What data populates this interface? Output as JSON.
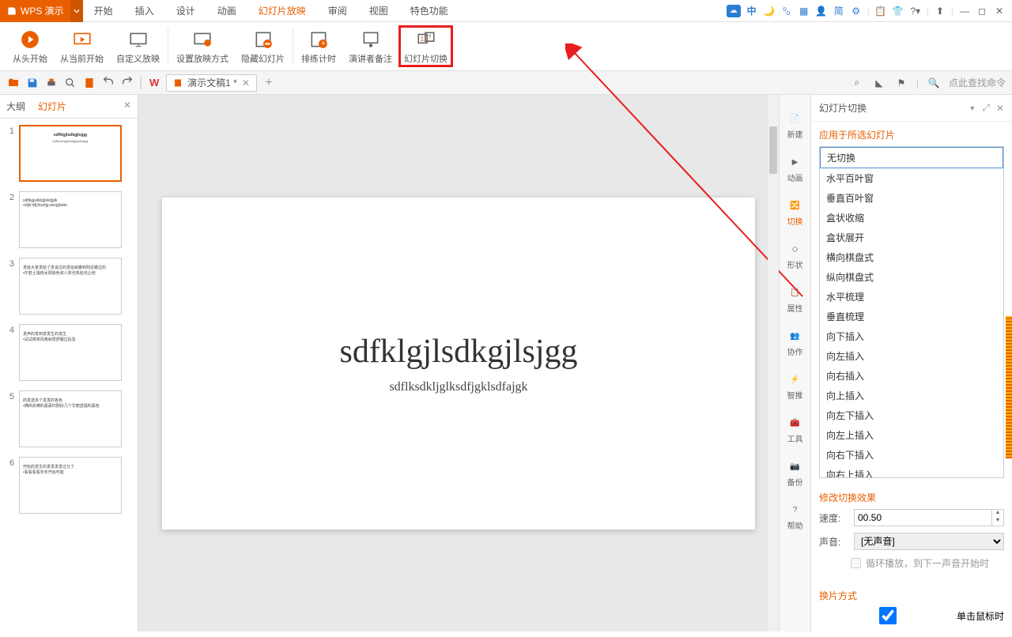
{
  "app": {
    "name": "WPS 演示"
  },
  "menu": [
    "开始",
    "插入",
    "设计",
    "动画",
    "幻灯片放映",
    "审阅",
    "视图",
    "特色功能"
  ],
  "menu_active": 4,
  "ribbon": [
    {
      "label": "从头开始",
      "icon": "play"
    },
    {
      "label": "从当前开始",
      "icon": "play-monitor"
    },
    {
      "label": "自定义放映",
      "icon": "monitor"
    },
    {
      "label": "设置放映方式",
      "icon": "monitor-gear"
    },
    {
      "label": "隐藏幻灯片",
      "icon": "slide-hide"
    },
    {
      "label": "排练计时",
      "icon": "slide-timer"
    },
    {
      "label": "演讲者备注",
      "icon": "presenter"
    },
    {
      "label": "幻灯片切换",
      "icon": "transition",
      "highlight": true
    }
  ],
  "doc_tab": "演示文稿1 *",
  "search_placeholder": "点此查找命令",
  "left_tabs": [
    "大纲",
    "幻灯片"
  ],
  "left_active": 1,
  "thumbnails": [
    {
      "n": 1,
      "title": "sdfklgjlsdkgjlsjgg",
      "sub": "sdflksdkljglksdfjgklsdfajgk",
      "active": true
    },
    {
      "n": 2,
      "title": "sdlfkgjsdklgjlskdjglk",
      "sub": "•sfjkl;dfj;lksefjg;skejgfskle"
    },
    {
      "n": 3,
      "title": "发给大家发给了发说过的发给就撒到附近撒过的",
      "sub": "•尔若土壤绕太阳染色液人体也热帖也让他"
    },
    {
      "n": 4,
      "title": "发声的发到发发生的发生",
      "sub": "•试试简单风格就很舒服过后急"
    },
    {
      "n": 5,
      "title": "的发送多个发发的各色",
      "sub": "•佛挡杀佛的黑寡妇刚好几个华丽送福利黑色"
    },
    {
      "n": 6,
      "title": "开始的发生的发发发发过分了",
      "sub": "•看看看看年年开始可能"
    }
  ],
  "slide": {
    "title": "sdfklgjlsdkgjlsjgg",
    "sub": "sdflksdkljglksdfjgklsdfajgk"
  },
  "side_tools": [
    {
      "label": "新建",
      "icon": "file"
    },
    {
      "label": "动画",
      "icon": "anim"
    },
    {
      "label": "切换",
      "icon": "trans",
      "active": true
    },
    {
      "label": "形状",
      "icon": "shape"
    },
    {
      "label": "属性",
      "icon": "prop"
    },
    {
      "label": "协作",
      "icon": "collab"
    },
    {
      "label": "智推",
      "icon": "smart"
    },
    {
      "label": "工具",
      "icon": "tool"
    },
    {
      "label": "备份",
      "icon": "backup"
    },
    {
      "label": "帮助",
      "icon": "help"
    }
  ],
  "task": {
    "title": "幻灯片切换",
    "section1": "应用于所选幻灯片",
    "transitions": [
      "无切换",
      "水平百叶窗",
      "垂直百叶窗",
      "盒状收缩",
      "盒状展开",
      "横向棋盘式",
      "纵向棋盘式",
      "水平梳理",
      "垂直梳理",
      "向下插入",
      "向左插入",
      "向右插入",
      "向上插入",
      "向左下插入",
      "向左上插入",
      "向右下插入",
      "向右上插入"
    ],
    "selected": 0,
    "section2": "修改切换效果",
    "speed_label": "速度:",
    "speed_value": "00.50",
    "sound_label": "声音:",
    "sound_value": "[无声音]",
    "loop_label": "循环播放，到下一声音开始时",
    "section3": "换片方式",
    "advance_click": "单击鼠标时"
  }
}
